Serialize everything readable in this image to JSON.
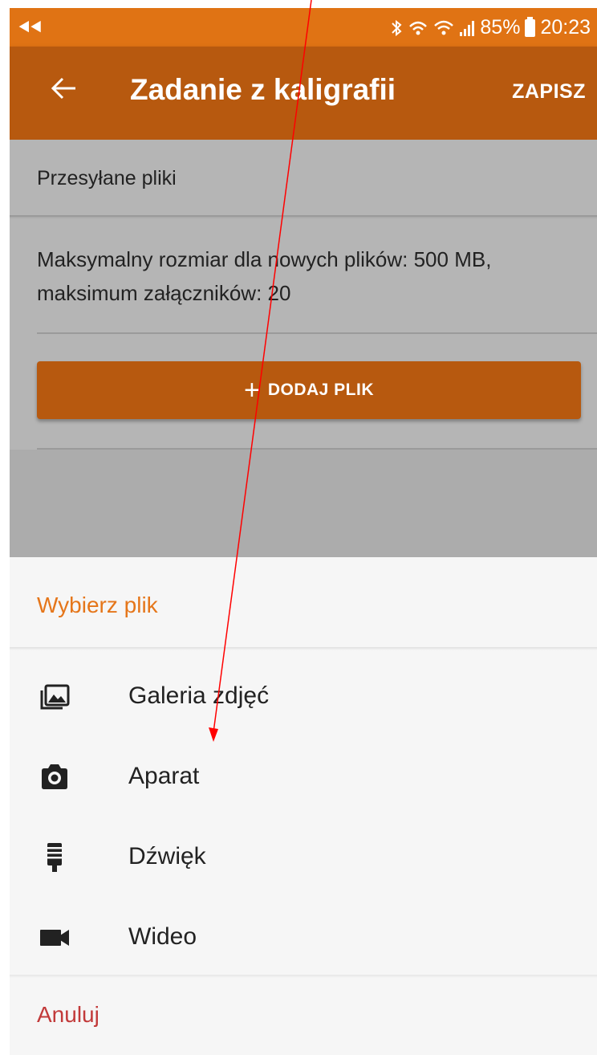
{
  "status_bar": {
    "battery": "85%",
    "time": "20:23"
  },
  "app_bar": {
    "title": "Zadanie z kaligrafii",
    "save_label": "ZAPISZ"
  },
  "form": {
    "section_label": "Przesyłane pliki",
    "limits_text": "Maksymalny rozmiar dla nowych plików: 500 MB, maksimum załączników: 20",
    "add_file_label": "DODAJ PLIK"
  },
  "sheet": {
    "title": "Wybierz plik",
    "options": [
      {
        "label": "Galeria zdjęć",
        "icon": "gallery-icon"
      },
      {
        "label": "Aparat",
        "icon": "camera-icon"
      },
      {
        "label": "Dźwięk",
        "icon": "microphone-icon"
      },
      {
        "label": "Wideo",
        "icon": "video-icon"
      }
    ],
    "cancel_label": "Anuluj"
  },
  "colors": {
    "status_bar": "#e07314",
    "app_bar": "#b7590f",
    "accent_title": "#e5761a",
    "cancel": "#c23a3a",
    "annotation_arrow": "#ff0000"
  }
}
